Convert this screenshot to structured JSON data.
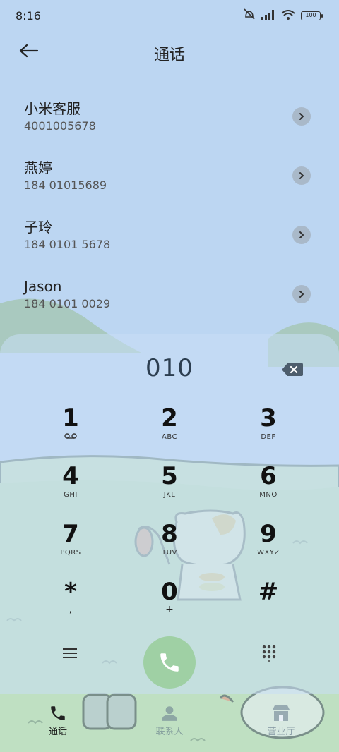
{
  "status_bar": {
    "time": "8:16",
    "battery": "100"
  },
  "header": {
    "title": "通话"
  },
  "contacts": [
    {
      "name": "小米客服",
      "number": "4001005678"
    },
    {
      "name": "燕婷",
      "number": "184 01015689"
    },
    {
      "name": "子玲",
      "number": "184 0101 5678"
    },
    {
      "name": "Jason",
      "number": "184 0101 0029"
    }
  ],
  "dialer": {
    "input": "010",
    "keys": [
      {
        "digit": "1",
        "letters": ""
      },
      {
        "digit": "2",
        "letters": "ABC"
      },
      {
        "digit": "3",
        "letters": "DEF"
      },
      {
        "digit": "4",
        "letters": "GHI"
      },
      {
        "digit": "5",
        "letters": "JKL"
      },
      {
        "digit": "6",
        "letters": "MNO"
      },
      {
        "digit": "7",
        "letters": "PQRS"
      },
      {
        "digit": "8",
        "letters": "TUV"
      },
      {
        "digit": "9",
        "letters": "WXYZ"
      },
      {
        "digit": "*",
        "letters": ","
      },
      {
        "digit": "0",
        "letters": "+"
      },
      {
        "digit": "#",
        "letters": ""
      }
    ]
  },
  "bottom_nav": [
    {
      "label": "通话",
      "icon": "phone-icon"
    },
    {
      "label": "联系人",
      "icon": "person-icon"
    },
    {
      "label": "营业厅",
      "icon": "shop-icon"
    }
  ],
  "colors": {
    "sky": "#bcd6f2",
    "grass": "#c5e3c8",
    "call_button": "#9fd0a4"
  }
}
